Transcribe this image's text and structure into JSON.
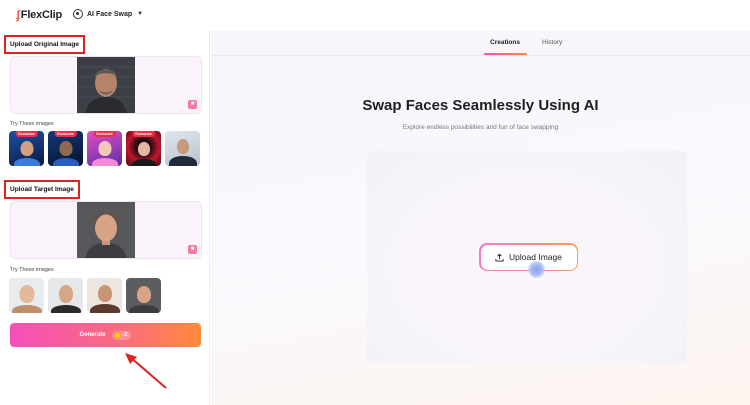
{
  "app": {
    "logo_text": "FlexClip",
    "logo_mark": "ʄ",
    "tool_name": "AI Face Swap"
  },
  "left_panel": {
    "original": {
      "title": "Upload Original Image",
      "try_label": "Try These images",
      "thumbnails": [
        {
          "badge": "Exclusive"
        },
        {
          "badge": "Exclusive"
        },
        {
          "badge": "Exclusive"
        },
        {
          "badge": "Exclusive"
        },
        {
          "badge": ""
        }
      ]
    },
    "target": {
      "title": "Upload Target Image",
      "try_label": "Try These images"
    },
    "generate": {
      "label": "Generate",
      "credit": "-2"
    }
  },
  "right_panel": {
    "tabs": [
      {
        "label": "Creations",
        "active": true
      },
      {
        "label": "History",
        "active": false
      }
    ],
    "headline": "Swap Faces Seamlessly Using AI",
    "subline": "Explore endless possibilities and fun of face swapping",
    "upload_button": "Upload Image"
  },
  "colors": {
    "accent_pink": "#f54fb9",
    "accent_orange": "#ff8a38",
    "highlight_red": "#dd2222",
    "badge_red": "#ea2e4a"
  }
}
